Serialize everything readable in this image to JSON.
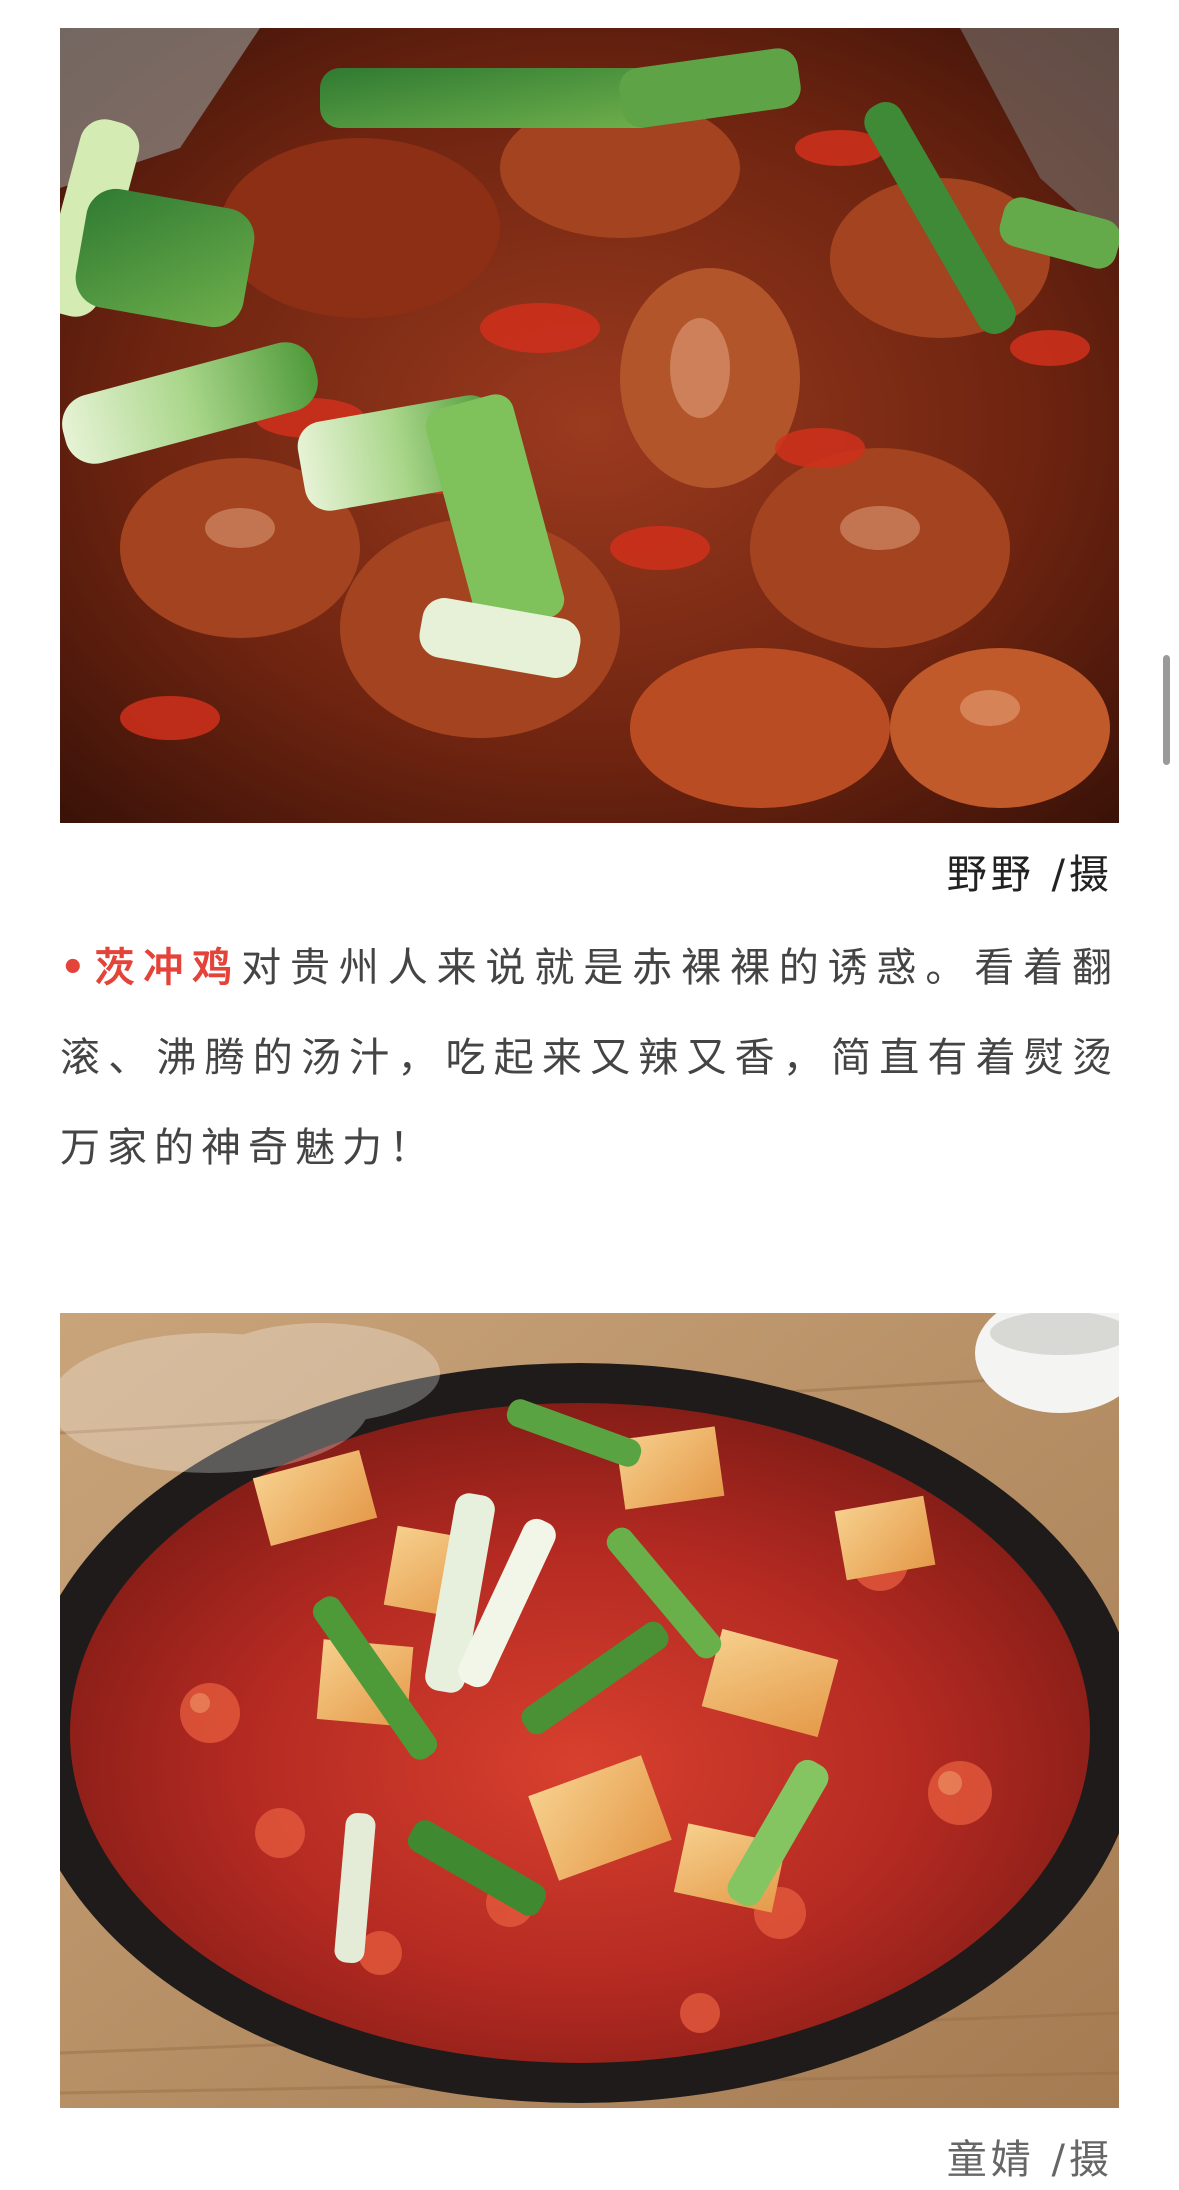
{
  "photos": [
    {
      "credit": "野野 /摄"
    },
    {
      "credit": "童婧 /摄"
    }
  ],
  "paragraph": {
    "bullet": "•",
    "highlight": "茨冲鸡",
    "text": "对贵州人来说就是赤裸裸的诱惑。看着翻滚、沸腾的汤汁，吃起来又辣又香，简直有着熨烫万家的神奇魅力！"
  },
  "colors": {
    "accent": "#e4433a",
    "text": "#444444",
    "background": "#ffffff"
  }
}
